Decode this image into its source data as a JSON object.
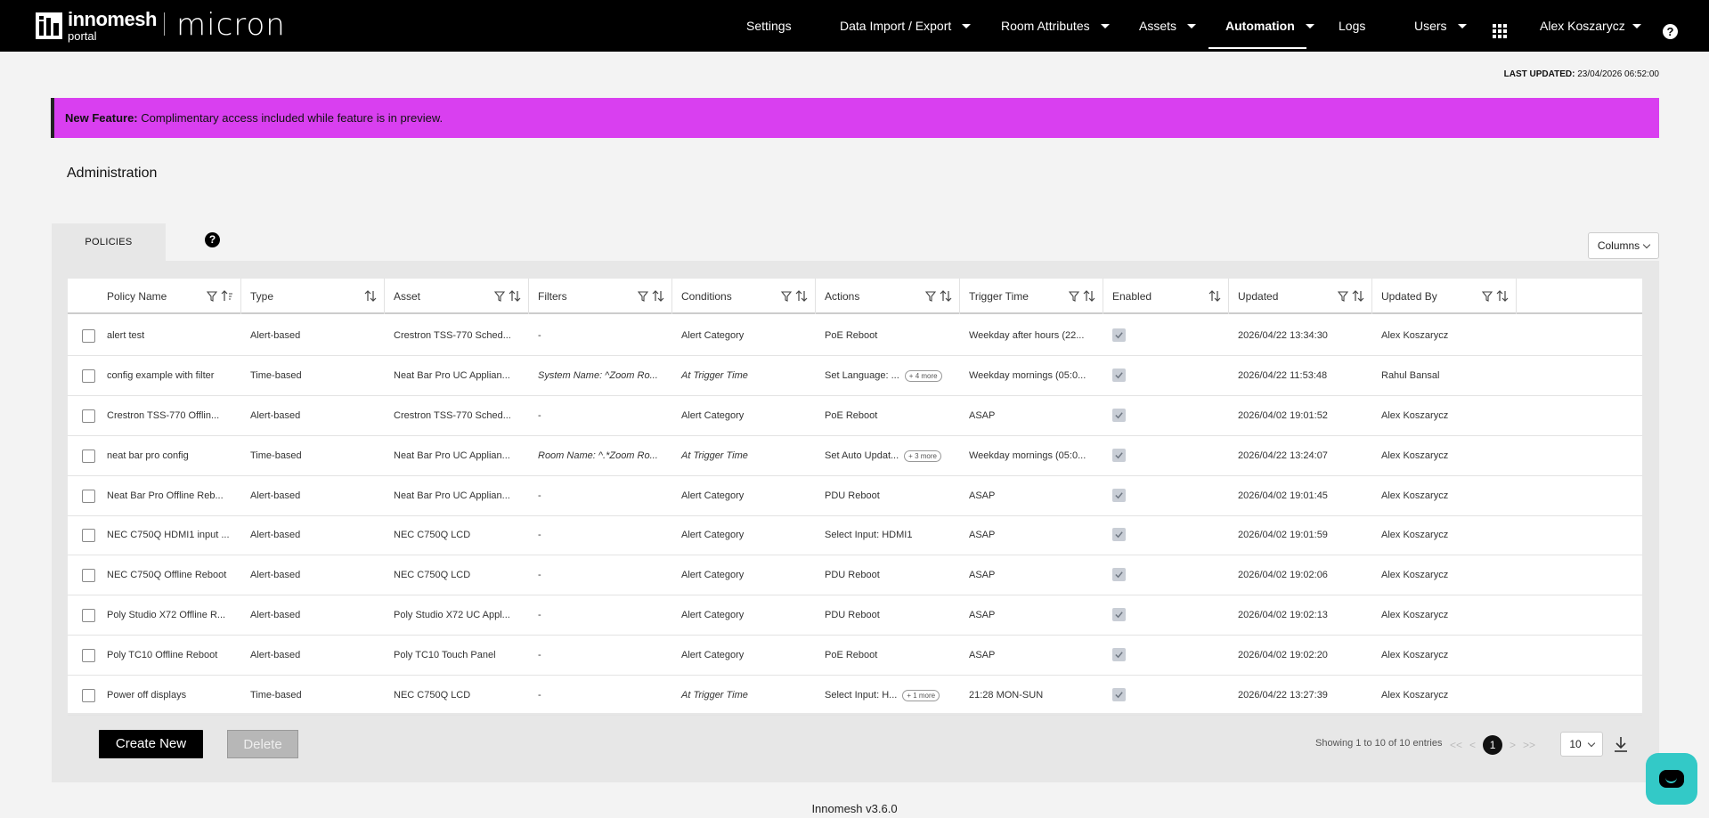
{
  "brand": {
    "name": "innomesh",
    "sub": "portal",
    "partner": "micron"
  },
  "nav": [
    {
      "label": "Settings",
      "dropdown": false
    },
    {
      "label": "Data Import / Export",
      "dropdown": true
    },
    {
      "label": "Room Attributes",
      "dropdown": true
    },
    {
      "label": "Assets",
      "dropdown": true
    },
    {
      "label": "Automation",
      "dropdown": true,
      "active": true
    },
    {
      "label": "Logs",
      "dropdown": false
    },
    {
      "label": "Users",
      "dropdown": true
    }
  ],
  "user": {
    "name": "Alex Koszarycz"
  },
  "icons": {
    "apps": "apps-grid-icon",
    "help": "help-icon"
  },
  "last_updated": {
    "label": "LAST UPDATED:",
    "value": "23/04/2026 06:52:00"
  },
  "banner": {
    "label": "New Feature:",
    "text": "Complimentary access included while feature is in preview.",
    "color": "#d93ff0"
  },
  "page_title": "Administration",
  "tabs": [
    {
      "label": "POLICIES"
    }
  ],
  "help_glyph": "?",
  "columns_button": "Columns",
  "table": {
    "columns": [
      "Policy Name",
      "Type",
      "Asset",
      "Filters",
      "Conditions",
      "Actions",
      "Trigger Time",
      "Enabled",
      "Updated",
      "Updated By"
    ],
    "rows": [
      {
        "name": "alert test",
        "type": "Alert-based",
        "asset": "Crestron TSS-770 Sched...",
        "filters": "-",
        "conditions": "Alert Category",
        "actions": "PoE Reboot",
        "more": "",
        "trigger": "Weekday after hours (22...",
        "enabled": true,
        "updated": "2026/04/22 13:34:30",
        "by": "Alex Koszarycz"
      },
      {
        "name": "config example with filter",
        "type": "Time-based",
        "asset": "Neat Bar Pro UC Applian...",
        "filters": "System Name: ^Zoom Ro...",
        "conditions": "At Trigger Time",
        "actions": "Set Language: ...",
        "more": "+ 4 more",
        "trigger": "Weekday mornings (05:0...",
        "enabled": true,
        "updated": "2026/04/22 11:53:48",
        "by": "Rahul Bansal"
      },
      {
        "name": "Crestron TSS-770 Offlin...",
        "type": "Alert-based",
        "asset": "Crestron TSS-770 Sched...",
        "filters": "-",
        "conditions": "Alert Category",
        "actions": "PoE Reboot",
        "more": "",
        "trigger": "ASAP",
        "enabled": true,
        "updated": "2026/04/02 19:01:52",
        "by": "Alex Koszarycz"
      },
      {
        "name": "neat bar pro config",
        "type": "Time-based",
        "asset": "Neat Bar Pro UC Applian...",
        "filters": "Room Name: ^.*Zoom Ro...",
        "conditions": "At Trigger Time",
        "actions": "Set Auto Updat...",
        "more": "+ 3 more",
        "trigger": "Weekday mornings (05:0...",
        "enabled": true,
        "updated": "2026/04/22 13:24:07",
        "by": "Alex Koszarycz"
      },
      {
        "name": "Neat Bar Pro Offline Reb...",
        "type": "Alert-based",
        "asset": "Neat Bar Pro UC Applian...",
        "filters": "-",
        "conditions": "Alert Category",
        "actions": "PDU Reboot",
        "more": "",
        "trigger": "ASAP",
        "enabled": true,
        "updated": "2026/04/02 19:01:45",
        "by": "Alex Koszarycz"
      },
      {
        "name": "NEC C750Q HDMI1 input ...",
        "type": "Alert-based",
        "asset": "NEC C750Q LCD",
        "filters": "-",
        "conditions": "Alert Category",
        "actions": "Select Input: HDMI1",
        "more": "",
        "trigger": "ASAP",
        "enabled": true,
        "updated": "2026/04/02 19:01:59",
        "by": "Alex Koszarycz"
      },
      {
        "name": "NEC C750Q Offline Reboot",
        "type": "Alert-based",
        "asset": "NEC C750Q LCD",
        "filters": "-",
        "conditions": "Alert Category",
        "actions": "PDU Reboot",
        "more": "",
        "trigger": "ASAP",
        "enabled": true,
        "updated": "2026/04/02 19:02:06",
        "by": "Alex Koszarycz"
      },
      {
        "name": "Poly Studio X72 Offline R...",
        "type": "Alert-based",
        "asset": "Poly Studio X72 UC Appl...",
        "filters": "-",
        "conditions": "Alert Category",
        "actions": "PDU Reboot",
        "more": "",
        "trigger": "ASAP",
        "enabled": true,
        "updated": "2026/04/02 19:02:13",
        "by": "Alex Koszarycz"
      },
      {
        "name": "Poly TC10 Offline Reboot",
        "type": "Alert-based",
        "asset": "Poly TC10 Touch Panel",
        "filters": "-",
        "conditions": "Alert Category",
        "actions": "PoE Reboot",
        "more": "",
        "trigger": "ASAP",
        "enabled": true,
        "updated": "2026/04/02 19:02:20",
        "by": "Alex Koszarycz"
      },
      {
        "name": "Power off displays",
        "type": "Time-based",
        "asset": "NEC C750Q LCD",
        "filters": "-",
        "conditions": "At Trigger Time",
        "actions": "Select Input: H...",
        "more": "+ 1 more",
        "trigger": "21:28 MON-SUN",
        "enabled": true,
        "updated": "2026/04/22 13:27:39",
        "by": "Alex Koszarycz"
      }
    ]
  },
  "buttons": {
    "create": "Create New",
    "delete": "Delete"
  },
  "pagination": {
    "showing": "Showing 1 to 10 of 10 entries",
    "first": "<<",
    "prev": "<",
    "page": "1",
    "next": ">",
    "last": ">>",
    "page_size": "10"
  },
  "footer": "Innomesh v3.6.0",
  "chat_color": "#33c9c7"
}
